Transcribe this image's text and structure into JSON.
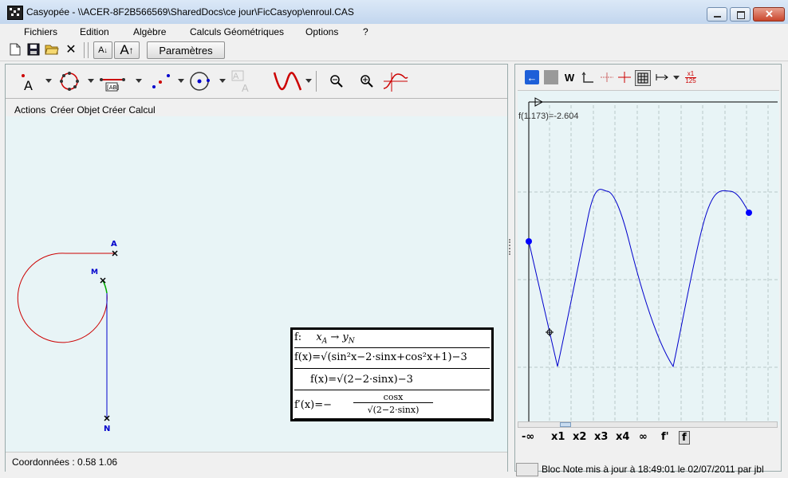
{
  "window": {
    "title": "Casyopée - \\\\ACER-8F2B566569\\SharedDocs\\ce jour\\FicCasyop\\enroul.CAS"
  },
  "menu": {
    "items": [
      "Fichiers",
      "Edition",
      "Algèbre",
      "Calculs Géométriques",
      "Options",
      "?"
    ]
  },
  "toolbar": {
    "params_label": "Paramètres",
    "font_small_label": "A",
    "font_big_label": "A"
  },
  "geometry_panel": {
    "submenu": [
      "Actions",
      "Créer Objet",
      "Créer Calcul"
    ],
    "status": "Coordonnées : 0.58 1.06",
    "point_A": "A",
    "point_M": "M",
    "point_N": "N",
    "segment_label": "[AB]"
  },
  "formula": {
    "line1_head": "f:",
    "line1_var": "x",
    "line1_var_sub": "A",
    "line1_arrow": "→",
    "line1_img": "y",
    "line1_img_sub": "N",
    "line2": "f(x)=√(sin²x−2·sinx+cos²x+1)−3",
    "line3": "f(x)=√(2−2·sinx)−3",
    "line4_lhs": "f′(x)=−",
    "line4_num": "cosx",
    "line4_den": "√(2−2·sinx)"
  },
  "graph_panel": {
    "w_label": "W",
    "scale_label_top": "x1",
    "scale_label_bottom": "125",
    "readout": "f(1.173)=-2.604",
    "x_buttons": [
      "-∞",
      "x1",
      "x2",
      "x3",
      "x4",
      "∞",
      "f'",
      "f"
    ],
    "bloc_note": "Bloc Note mis à jour à 18:49:01  le 02/07/2011  par jbl"
  },
  "colors": {
    "curve": "#0000cc",
    "circle": "#cc0000",
    "segment": "#0000cc",
    "panel_bg": "#e8f4f6"
  }
}
